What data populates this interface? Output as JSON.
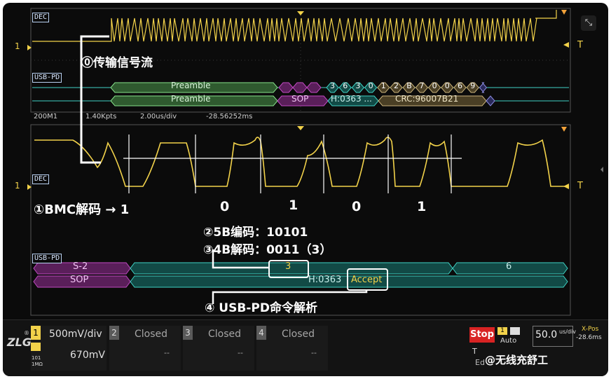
{
  "top_panel": {
    "dec_label": "DEC",
    "annotation_0": "⓪传输信号流",
    "bus_label": "USB-PD",
    "preamble_1": "Preamble",
    "preamble_2": "Preamble",
    "sop": "SOP",
    "header": "H:0363 ...",
    "crc": "CRC:96007B21",
    "row1_dots": "...",
    "hex_digits": [
      "3",
      "6",
      "3",
      "0",
      "1",
      "2",
      "B",
      "7",
      "0",
      "0",
      "6",
      "9"
    ],
    "level_marker": "1",
    "trigger_marker": "T"
  },
  "info_bar": {
    "zoom": "200M1",
    "points": "1.40Kpts",
    "timebase": "2.00us/div",
    "position": "-28.56252ms"
  },
  "zoom_panel": {
    "dec_label": "DEC",
    "bus_label": "USB-PD",
    "level_marker": "1",
    "trigger_marker": "T",
    "annotation_1": "①BMC解码 → 1",
    "bits": [
      "0",
      "1",
      "0",
      "1"
    ],
    "annotation_2": "②5B编码：10101",
    "annotation_3": "③4B解码：0011（3）",
    "annotation_4": "④ USB-PD命令解析",
    "row1_s2": "S-2",
    "row1_value": "3",
    "row1_value2": "6",
    "row2_sop": "SOP",
    "row2_header": "H:0363",
    "row2_accept": "Accept"
  },
  "channels": [
    {
      "num": "1",
      "color": "#f2d24a",
      "volts": "500mV/div",
      "offset": "670mV",
      "coupling": "101",
      "impedance": "1MΩ"
    },
    {
      "num": "2",
      "color": "#5a5a5a",
      "state": "Closed",
      "dash": "--"
    },
    {
      "num": "3",
      "color": "#5a5a5a",
      "state": "Closed",
      "dash": "--"
    },
    {
      "num": "4",
      "color": "#5a5a5a",
      "state": "Closed",
      "dash": "--"
    }
  ],
  "acquisition": {
    "run_state": "Stop",
    "trigger_mode": "Auto",
    "trigger_src": "1",
    "time_scale": "50.0",
    "time_unit": "us/div",
    "xpos_label": "X-Pos",
    "xpos_value": "-28.6ms",
    "t_label": "T",
    "edge_label": "Ed"
  },
  "watermark": "@无线充舒工",
  "colors": {
    "yellow": "#f2d24a",
    "cyan": "#3fd2c4",
    "green": "#86e08a",
    "magenta": "#c04ac2",
    "white": "#ffffff",
    "red": "#d82323"
  }
}
